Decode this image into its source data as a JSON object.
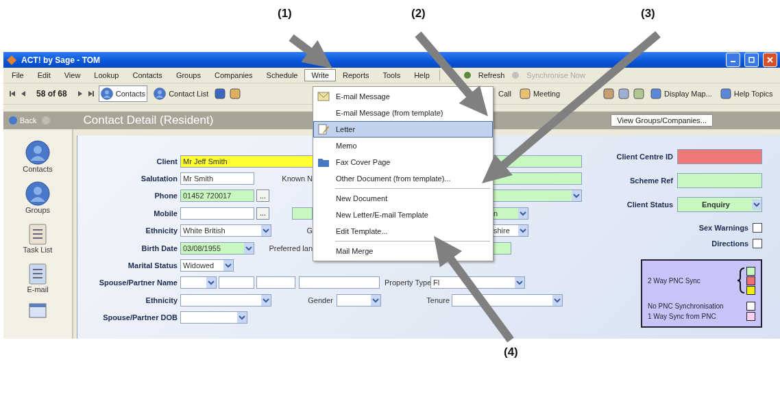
{
  "annotations": [
    {
      "label": "(1)"
    },
    {
      "label": "(2)"
    },
    {
      "label": "(3)"
    },
    {
      "label": "(4)"
    }
  ],
  "window": {
    "title": "ACT! by Sage - TOM"
  },
  "menu_bar": [
    {
      "label": "File",
      "selected": false,
      "disabled": false
    },
    {
      "label": "Edit",
      "selected": false,
      "disabled": false
    },
    {
      "label": "View",
      "selected": false,
      "disabled": false
    },
    {
      "label": "Lookup",
      "selected": false,
      "disabled": false
    },
    {
      "label": "Contacts",
      "selected": false,
      "disabled": false
    },
    {
      "label": "Groups",
      "selected": false,
      "disabled": false
    },
    {
      "label": "Companies",
      "selected": false,
      "disabled": false
    },
    {
      "label": "Schedule",
      "selected": false,
      "disabled": false
    },
    {
      "label": "Write",
      "selected": true,
      "disabled": false
    },
    {
      "label": "Reports",
      "selected": false,
      "disabled": false
    },
    {
      "label": "Tools",
      "selected": false,
      "disabled": false
    },
    {
      "label": "Help",
      "selected": false,
      "disabled": false
    },
    {
      "label": "Refresh",
      "selected": false,
      "disabled": false
    },
    {
      "label": "Synchronise Now",
      "selected": false,
      "disabled": true
    }
  ],
  "toolbar": {
    "record_counter": "58 of 68",
    "views": [
      {
        "label": "Contacts",
        "selected": true
      },
      {
        "label": "Contact List",
        "selected": false
      }
    ],
    "actions": [
      {
        "label": "Call"
      },
      {
        "label": "Meeting"
      },
      {
        "label": "Display Map..."
      },
      {
        "label": "Help Topics"
      }
    ]
  },
  "header": {
    "back": "Back",
    "title": "Contact Detail (Resident)",
    "button": "View Groups/Companies..."
  },
  "sidebar": [
    {
      "label": "Contacts"
    },
    {
      "label": "Groups"
    },
    {
      "label": "Task List"
    },
    {
      "label": "E-mail"
    }
  ],
  "write_menu": [
    {
      "kind": "icon",
      "label": "E-mail Message",
      "selected": false
    },
    {
      "kind": "plain",
      "label": "E-mail Message (from template)",
      "selected": false
    },
    {
      "kind": "icon",
      "label": "Letter",
      "selected": true
    },
    {
      "kind": "plain",
      "label": "Memo",
      "selected": false
    },
    {
      "kind": "icon",
      "label": "Fax Cover Page",
      "selected": false
    },
    {
      "kind": "plain",
      "label": "Other Document (from template)...",
      "selected": false
    },
    {
      "kind": "separator"
    },
    {
      "kind": "plain",
      "label": "New Document",
      "selected": false
    },
    {
      "kind": "plain",
      "label": "New Letter/E-mail Template",
      "selected": false
    },
    {
      "kind": "plain",
      "label": "Edit Template...",
      "selected": false
    },
    {
      "kind": "separator"
    },
    {
      "kind": "plain",
      "label": "Mail Merge",
      "selected": false
    }
  ],
  "form": {
    "rows": [
      {
        "label": "Client",
        "items": [
          {
            "kind": "text",
            "value": "Mr Jeff Smith",
            "color": "#ffff33"
          },
          {
            "kind": "text",
            "color": "#c8f8c0"
          }
        ]
      },
      {
        "label": "Salutation",
        "items": [
          {
            "kind": "text",
            "value": "Mr Smith",
            "color": "#ffffff"
          },
          {
            "kind": "caption",
            "text": "Known N"
          },
          {
            "kind": "text",
            "color": "#c8f8c0"
          }
        ]
      },
      {
        "label": "Phone",
        "items": [
          {
            "kind": "text",
            "value": "01452 720017",
            "color": "#c8f8c0"
          },
          {
            "kind": "button",
            "label": "..."
          },
          {
            "kind": "combo",
            "color": "#c8f8c0"
          }
        ]
      },
      {
        "label": "Mobile",
        "items": [
          {
            "kind": "text",
            "color": "#ffffff"
          },
          {
            "kind": "button",
            "label": "..."
          },
          {
            "kind": "text",
            "color": "#c8f8c0"
          },
          {
            "kind": "combo",
            "value": "n",
            "color": "#c8f8c0"
          }
        ]
      },
      {
        "label": "Ethnicity",
        "items": [
          {
            "kind": "combo",
            "value": "White British",
            "color": "#ffffff"
          },
          {
            "kind": "caption",
            "text": "G"
          },
          {
            "kind": "combo",
            "value": "shire",
            "color": "#ffffff"
          }
        ]
      },
      {
        "label": "Birth Date",
        "items": [
          {
            "kind": "combo",
            "value": "03/08/1955",
            "color": "#c8f8c0"
          },
          {
            "kind": "caption",
            "text": "Preferred lan"
          },
          {
            "kind": "text",
            "color": "#c8f8c0"
          }
        ]
      },
      {
        "label": "Marital Status",
        "items": [
          {
            "kind": "combo",
            "value": "Widowed",
            "color": "#ffffff"
          }
        ]
      },
      {
        "label": "Spouse/Partner Name",
        "items": [
          {
            "kind": "combo",
            "color": "#ffffff"
          },
          {
            "kind": "text",
            "color": "#ffffff"
          },
          {
            "kind": "text",
            "color": "#ffffff"
          },
          {
            "kind": "text",
            "color": "#ffffff"
          },
          {
            "kind": "caption",
            "text": "Property Type"
          },
          {
            "kind": "combo",
            "value": "Fl",
            "color": "#ffffff"
          }
        ]
      },
      {
        "label": "Ethnicity",
        "items": [
          {
            "kind": "combo",
            "color": "#ffffff"
          },
          {
            "kind": "caption",
            "text": "Gender"
          },
          {
            "kind": "combo",
            "color": "#ffffff"
          },
          {
            "kind": "caption",
            "text": "Tenure"
          },
          {
            "kind": "combo",
            "color": "#ffffff"
          }
        ]
      },
      {
        "label": "Spouse/Partner DOB",
        "items": [
          {
            "kind": "combo",
            "color": "#ffffff"
          }
        ]
      }
    ],
    "right": [
      {
        "kind": "text",
        "label": "Client Centre ID",
        "color": "#f07878"
      },
      {
        "kind": "text",
        "label": "Scheme Ref",
        "color": "#c8f8c0"
      },
      {
        "kind": "combo",
        "label": "Client Status",
        "value": "Enquiry",
        "color": "#c8f8c0"
      },
      {
        "kind": "checkbox",
        "label": "Sex Warnings",
        "checked": false
      },
      {
        "kind": "checkbox",
        "label": "Directions",
        "checked": false
      }
    ],
    "legend": [
      {
        "kind": "group",
        "label": "2 Way PNC Sync",
        "swatches": [
          {
            "color": "#c8f8c0"
          },
          {
            "color": "#ee7070"
          },
          {
            "color": "#f0f000"
          }
        ]
      },
      {
        "kind": "single",
        "label": "No PNC Synchronisation",
        "swatches": [
          {
            "color": "#ffffff"
          }
        ]
      },
      {
        "kind": "single",
        "label": "1 Way Sync from PNC",
        "swatches": [
          {
            "color": "#ffd0f0"
          }
        ]
      }
    ]
  }
}
